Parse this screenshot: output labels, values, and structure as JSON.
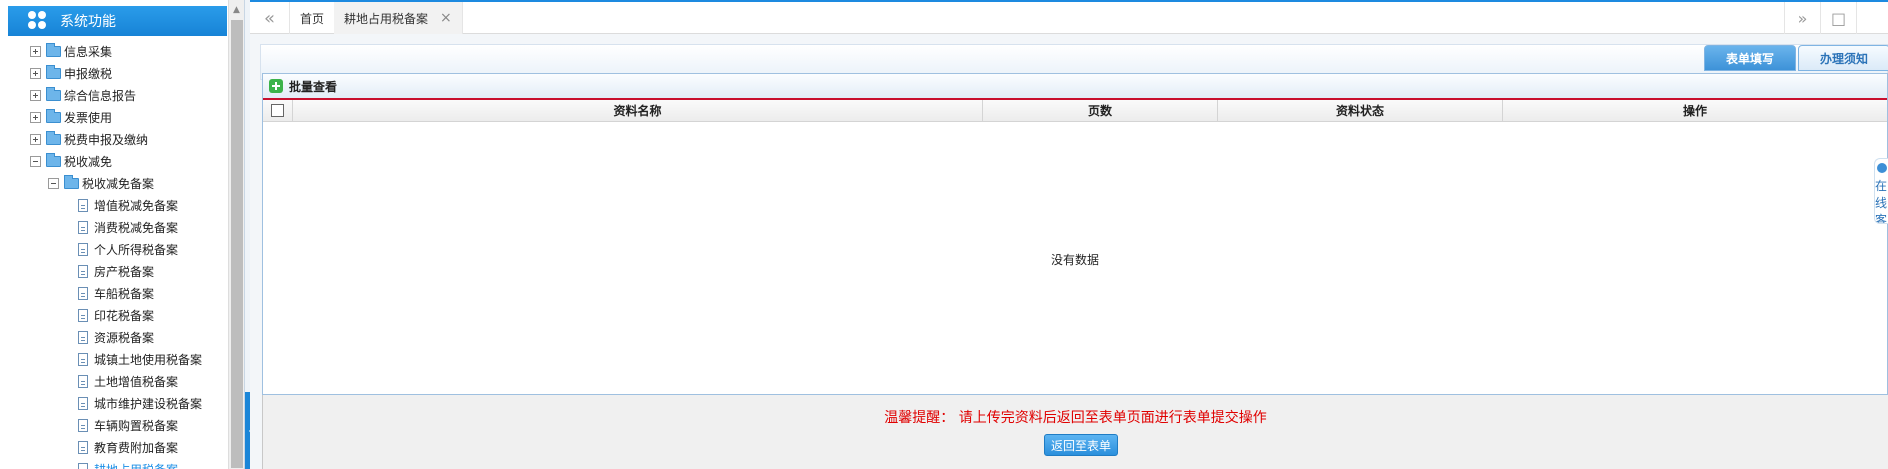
{
  "sidebar": {
    "title": "系统功能",
    "items": [
      {
        "label": "信息采集",
        "type": "folder",
        "state": "collapsed",
        "level": 0
      },
      {
        "label": "申报缴税",
        "type": "folder",
        "state": "collapsed",
        "level": 0
      },
      {
        "label": "综合信息报告",
        "type": "folder",
        "state": "collapsed",
        "level": 0
      },
      {
        "label": "发票使用",
        "type": "folder",
        "state": "collapsed",
        "level": 0
      },
      {
        "label": "税费申报及缴纳",
        "type": "folder",
        "state": "collapsed",
        "level": 0
      },
      {
        "label": "税收减免",
        "type": "folder",
        "state": "expanded",
        "level": 0
      },
      {
        "label": "税收减免备案",
        "type": "folder",
        "state": "expanded",
        "level": 1
      },
      {
        "label": "增值税减免备案",
        "type": "doc",
        "level": 2
      },
      {
        "label": "消费税减免备案",
        "type": "doc",
        "level": 2
      },
      {
        "label": "个人所得税备案",
        "type": "doc",
        "level": 2
      },
      {
        "label": "房产税备案",
        "type": "doc",
        "level": 2
      },
      {
        "label": "车船税备案",
        "type": "doc",
        "level": 2
      },
      {
        "label": "印花税备案",
        "type": "doc",
        "level": 2
      },
      {
        "label": "资源税备案",
        "type": "doc",
        "level": 2
      },
      {
        "label": "城镇土地使用税备案",
        "type": "doc",
        "level": 2
      },
      {
        "label": "土地增值税备案",
        "type": "doc",
        "level": 2
      },
      {
        "label": "城市维护建设税备案",
        "type": "doc",
        "level": 2
      },
      {
        "label": "车辆购置税备案",
        "type": "doc",
        "level": 2
      },
      {
        "label": "教育费附加备案",
        "type": "doc",
        "level": 2
      },
      {
        "label": "耕地占用税备案",
        "type": "doc",
        "level": 2,
        "active": true
      }
    ]
  },
  "tabs": {
    "nav_left": "«",
    "home": "首页",
    "current": "耕地占用税备案",
    "close": "×",
    "nav_right": "»",
    "window": "□"
  },
  "form_tabs": [
    "表单填写",
    "办理须知"
  ],
  "grid": {
    "title": "批量查看",
    "columns": [
      "资料名称",
      "页数",
      "资料状态",
      "操作"
    ],
    "empty_text": "没有数据"
  },
  "footer": {
    "tip": "温馨提醒： 请上传完资料后返回至表单页面进行表单提交操作",
    "back_button": "返回至表单"
  },
  "service": {
    "label": "在线客"
  },
  "colors": {
    "accent": "#1d8ae0",
    "warning": "#e00000",
    "header_rule": "#c8102e"
  }
}
